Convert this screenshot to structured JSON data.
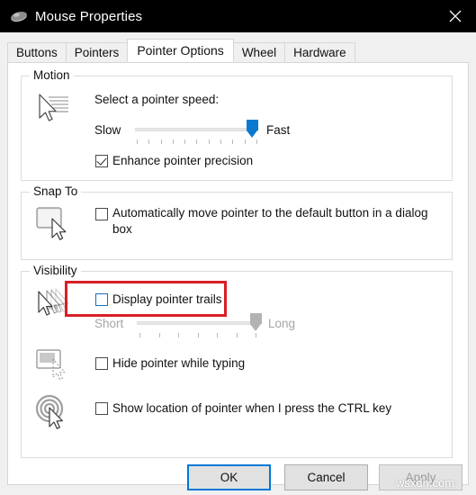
{
  "window": {
    "title": "Mouse Properties",
    "icon": "mouse-icon",
    "close_label": "✕"
  },
  "tabs": [
    {
      "label": "Buttons",
      "active": false
    },
    {
      "label": "Pointers",
      "active": false
    },
    {
      "label": "Pointer Options",
      "active": true
    },
    {
      "label": "Wheel",
      "active": false
    },
    {
      "label": "Hardware",
      "active": false
    }
  ],
  "motion": {
    "group_title": "Motion",
    "icon": "pointer-motion-icon",
    "prompt": "Select a pointer speed:",
    "slider": {
      "min_label": "Slow",
      "max_label": "Fast",
      "value_percent": 95,
      "tick_count": 11,
      "enabled": true
    },
    "enhance_precision": {
      "label": "Enhance pointer precision",
      "checked": true
    }
  },
  "snap_to": {
    "group_title": "Snap To",
    "icon": "default-button-pointer-icon",
    "auto_move": {
      "label_line1": "Automatically move pointer to the default button in a dialog",
      "label_line2": "box",
      "checked": false
    }
  },
  "visibility": {
    "group_title": "Visibility",
    "trails": {
      "icon": "pointer-trails-icon",
      "label": "Display pointer trails",
      "checked": false,
      "focused": true,
      "highlighted": true,
      "slider": {
        "min_label": "Short",
        "max_label": "Long",
        "value_percent": 92,
        "tick_count": 7,
        "enabled": false
      }
    },
    "hide_while_typing": {
      "icon": "hide-pointer-typing-icon",
      "label": "Hide pointer while typing",
      "checked": false
    },
    "show_location": {
      "icon": "pointer-location-ctrl-icon",
      "label": "Show location of pointer when I press the CTRL key",
      "checked": false
    }
  },
  "footer": {
    "ok": "OK",
    "cancel": "Cancel",
    "apply": "Apply",
    "apply_enabled": false
  },
  "watermark": "wsxdn.com",
  "colors": {
    "accent": "#0078d7",
    "slider_blue": "#0b79d0",
    "highlight_red": "#d81f26",
    "titlebar": "#000000"
  }
}
